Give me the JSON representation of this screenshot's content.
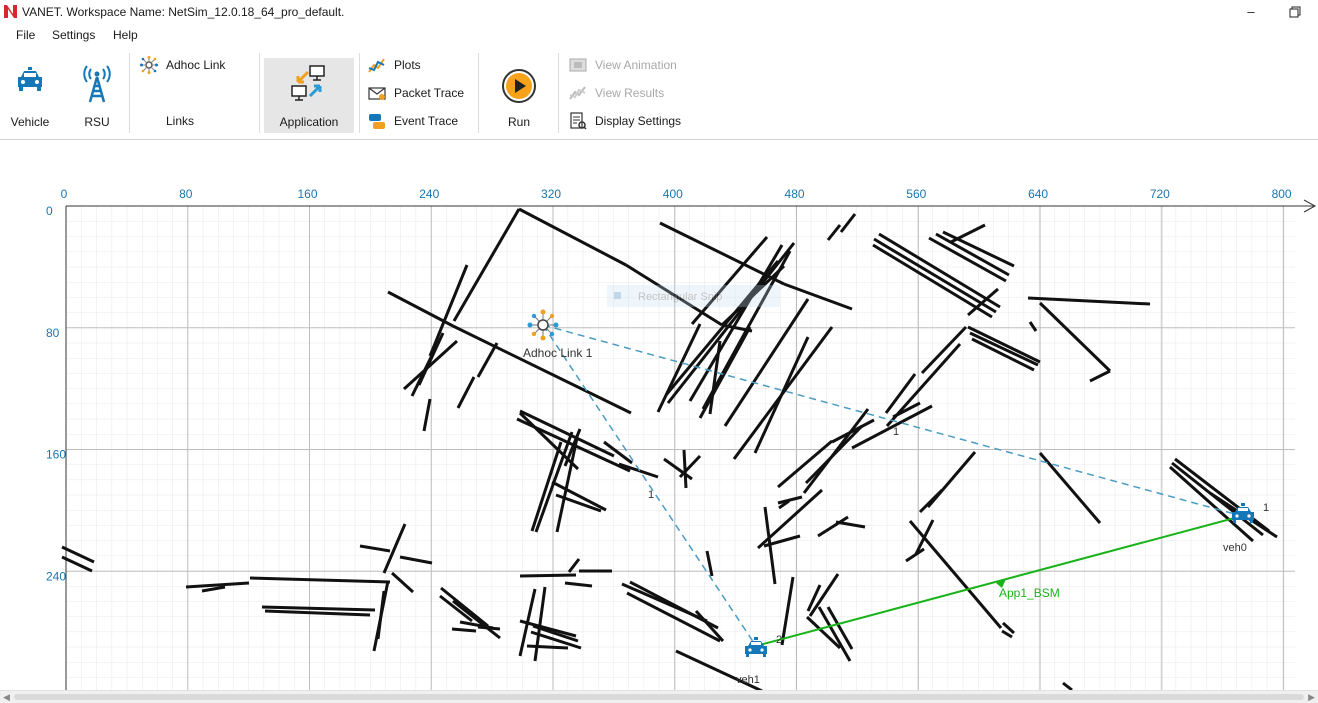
{
  "window": {
    "title": "VANET. Workspace Name: NetSim_12.0.18_64_pro_default."
  },
  "menu": [
    {
      "label": "File"
    },
    {
      "label": "Settings"
    },
    {
      "label": "Help"
    }
  ],
  "ribbon": {
    "vehicle": "Vehicle",
    "rsu": "RSU",
    "adhoc_link": "Adhoc Link",
    "links_group": "Links",
    "application": "Application",
    "plots": "Plots",
    "packet_trace": "Packet Trace",
    "event_trace": "Event Trace",
    "run": "Run",
    "view_animation": "View Animation",
    "view_results": "View Results",
    "display_settings": "Display Settings"
  },
  "canvas": {
    "x_ticks": [
      "0",
      "80",
      "160",
      "240",
      "320",
      "400",
      "480",
      "560",
      "640",
      "720",
      "800"
    ],
    "y_ticks": [
      "0",
      "80",
      "160",
      "240"
    ],
    "x_tick_values": [
      0,
      80,
      160,
      240,
      320,
      400,
      480,
      560,
      640,
      720,
      800
    ],
    "y_tick_values": [
      0,
      80,
      160,
      240
    ],
    "overlay_text": "Rectangular Snip",
    "nodes": {
      "adhoc": {
        "label": "Adhoc Link 1",
        "x": 313,
        "y": 77
      },
      "veh0": {
        "label": "veh0",
        "port": "1",
        "x": 775,
        "y": 200
      },
      "veh1": {
        "label": "veh1",
        "port": "2",
        "x": 454,
        "y": 288
      }
    },
    "link_labels": {
      "to_veh0": "1",
      "to_veh1": "1"
    },
    "app_flow": {
      "label": "App1_BSM",
      "x": 617,
      "y": 242
    }
  },
  "colors": {
    "accent": "#1478b8",
    "link": "#4a9cc1",
    "app": "#19b319",
    "axis": "#1a76b0"
  }
}
